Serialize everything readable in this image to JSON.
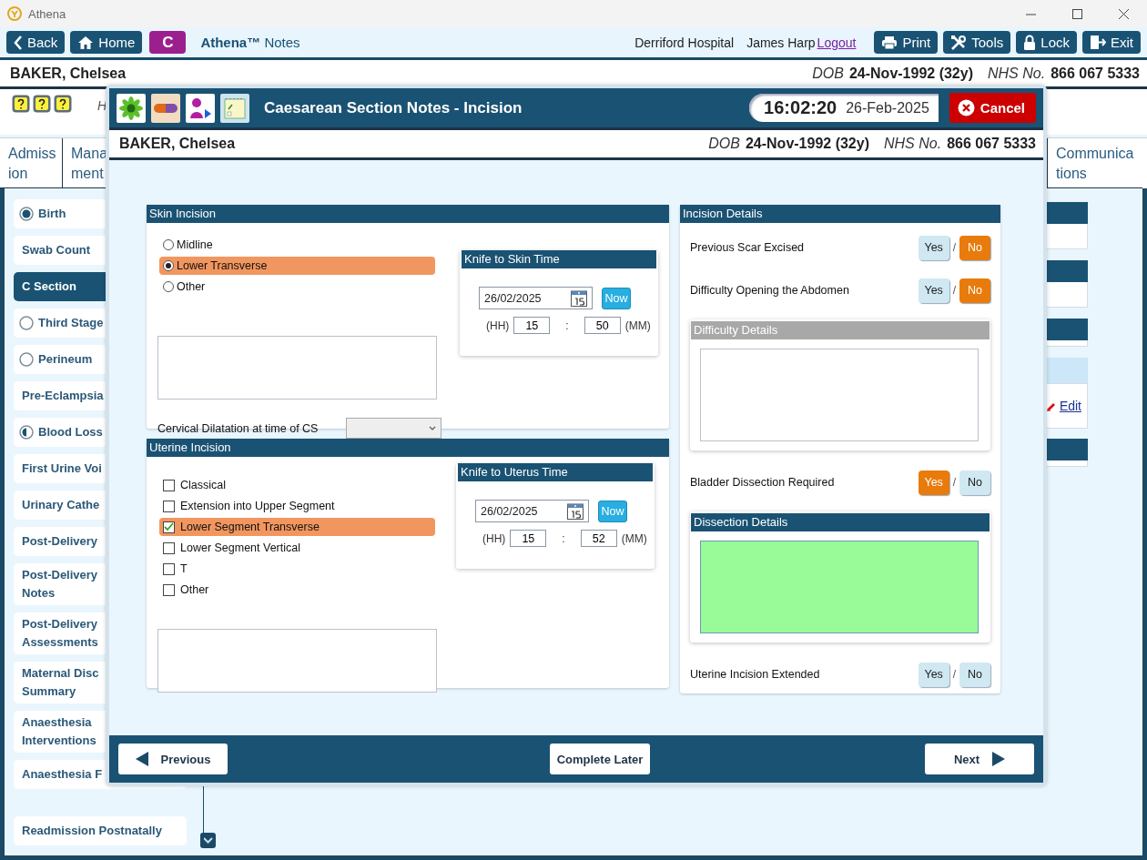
{
  "window": {
    "title": "Athena"
  },
  "toolbar": {
    "nav": [
      {
        "kind": "back",
        "label": "Back"
      },
      {
        "kind": "home",
        "label": "Home"
      }
    ],
    "user_badge": "C",
    "app_name": "**Athena™** Notes",
    "hospital": "Derriford Hospital",
    "user": "James Harp",
    "logout": "Logout",
    "actions": [
      {
        "kind": "print",
        "label": "Print"
      },
      {
        "kind": "tools",
        "label": "Tools"
      },
      {
        "kind": "lock",
        "label": "Lock"
      },
      {
        "kind": "exit",
        "label": "Exit"
      }
    ]
  },
  "patient": {
    "name": "BAKER, Chelsea",
    "dob_label": "DOB",
    "dob": "24-Nov-1992 (32y)",
    "nhs_label": "NHS No.",
    "nhs": "866 067 5333"
  },
  "alerts": {
    "note": "H"
  },
  "tabs": [
    {
      "lines": [
        "Admiss",
        "ion"
      ],
      "selected": false
    },
    {
      "lines": [
        "Mana",
        "ment"
      ],
      "selected": false
    },
    {
      "lines": [
        "Communica",
        "tions"
      ],
      "selected": false
    }
  ],
  "sidebar": {
    "items": [
      {
        "label": "Birth",
        "kind": "complete",
        "selected": false
      },
      {
        "label": "Swab Count",
        "kind": "plain",
        "selected": false
      },
      {
        "label": "C Section",
        "kind": "plain",
        "selected": true
      },
      {
        "label": "Third Stage",
        "kind": "empty",
        "selected": false
      },
      {
        "label": "Perineum",
        "kind": "empty",
        "selected": false
      },
      {
        "label": "Pre-Eclampsia",
        "kind": "plain",
        "selected": false
      },
      {
        "label": "Blood Loss",
        "kind": "partial",
        "selected": false
      },
      {
        "label": "First Urine Voi",
        "kind": "plain",
        "selected": false
      },
      {
        "label": "Urinary Cathe",
        "kind": "plain",
        "selected": false
      },
      {
        "label": "Post-Delivery",
        "kind": "plain",
        "selected": false
      },
      {
        "lines": [
          "Post-Delivery",
          "Notes"
        ],
        "kind": "plain",
        "selected": false
      },
      {
        "lines": [
          "Post-Delivery",
          "Assessments"
        ],
        "kind": "plain",
        "selected": false
      },
      {
        "lines": [
          "Maternal Disc",
          "Summary"
        ],
        "kind": "plain",
        "selected": false
      },
      {
        "lines": [
          "Anaesthesia",
          "Interventions"
        ],
        "kind": "plain",
        "selected": false
      },
      {
        "label": "Anaesthesia F",
        "kind": "plain",
        "selected": false
      },
      {
        "label": "Readmission Postnatally",
        "kind": "separated",
        "selected": false
      }
    ]
  },
  "side_panels": {
    "edit_link": "Edit"
  },
  "modal": {
    "title": "Caesarean Section Notes - Incision",
    "clock": {
      "time": "16:02:20",
      "date": "26-Feb-2025"
    },
    "cancel": "Cancel",
    "patient": {
      "name": "BAKER, Chelsea",
      "dob_label": "DOB",
      "dob": "24-Nov-1992 (32y)",
      "nhs_label": "NHS No.",
      "nhs": "866 067 5333"
    },
    "skin_incision": {
      "title": "Skin Incision",
      "options": [
        {
          "label": "Midline",
          "selected": false
        },
        {
          "label": "Lower Transverse",
          "selected": true
        },
        {
          "label": "Other",
          "selected": false
        }
      ],
      "cervical_label": "Cervical Dilatation at time of CS",
      "knife_time": {
        "title": "Knife to Skin Time",
        "date": "26/02/2025",
        "now": "Now",
        "hh_label": "(HH)",
        "hh": "15",
        "separator": ":",
        "mm": "50",
        "mm_label": "(MM)"
      }
    },
    "uterine_incision": {
      "title": "Uterine Incision",
      "options": [
        {
          "label": "Classical",
          "checked": false
        },
        {
          "label": "Extension into Upper Segment",
          "checked": false
        },
        {
          "label": "Lower Segment Transverse",
          "checked": true
        },
        {
          "label": "Lower Segment Vertical",
          "checked": false
        },
        {
          "label": "T",
          "checked": false
        },
        {
          "label": "Other",
          "checked": false
        }
      ],
      "knife_time": {
        "title": "Knife to Uterus Time",
        "date": "26/02/2025",
        "now": "Now",
        "hh_label": "(HH)",
        "hh": "15",
        "separator": ":",
        "mm": "52",
        "mm_label": "(MM)"
      }
    },
    "incision_details": {
      "title": "Incision Details",
      "items": [
        {
          "kind": "question",
          "label": "Previous Scar Excised",
          "options": [
            {
              "label": "Yes",
              "selected": false
            },
            {
              "label": "No",
              "selected": true
            }
          ],
          "separator": "/"
        },
        {
          "kind": "question",
          "label": "Difficulty Opening the Abdomen",
          "options": [
            {
              "label": "Yes",
              "selected": false
            },
            {
              "label": "No",
              "selected": true
            }
          ],
          "separator": "/"
        },
        {
          "kind": "details",
          "title": "Difficulty Details",
          "disabled": true,
          "focused": false
        },
        {
          "kind": "question",
          "label": "Bladder Dissection Required",
          "options": [
            {
              "label": "Yes",
              "selected": true
            },
            {
              "label": "No",
              "selected": false
            }
          ],
          "separator": "/"
        },
        {
          "kind": "details",
          "title": "Dissection Details",
          "disabled": false,
          "focused": true
        },
        {
          "kind": "question",
          "label": "Uterine Incision Extended",
          "options": [
            {
              "label": "Yes",
              "selected": false
            },
            {
              "label": "No",
              "selected": false
            }
          ],
          "separator": "/"
        }
      ]
    },
    "footer": {
      "previous": "Previous",
      "complete_later": "Complete Later",
      "next": "Next"
    }
  }
}
